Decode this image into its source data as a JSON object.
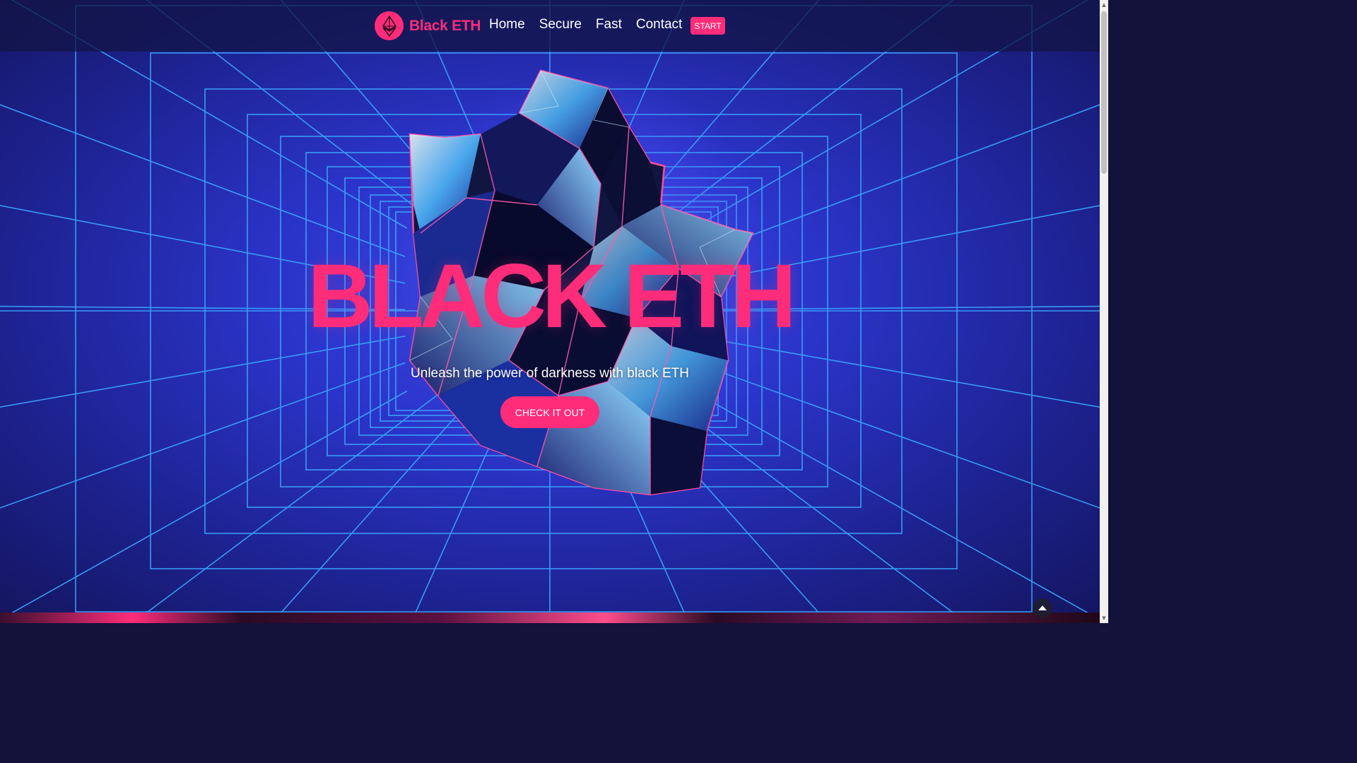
{
  "navbar": {
    "brand_name": "Black ETH",
    "links": [
      "Home",
      "Secure",
      "Fast",
      "Contact"
    ],
    "start_label": "START"
  },
  "hero": {
    "title": "BLACK ETH",
    "subtitle": "Unleash the power of darkness with black ETH",
    "cta_label": "CHECK IT OUT"
  },
  "icons": {
    "brand_logo": "ethereum-icon",
    "scroll_top": "caret-up-icon"
  },
  "colors": {
    "accent": "#ff2c7a",
    "grid_line": "#3aa8ff",
    "background": "#2b34c9",
    "navbar": "#121446"
  }
}
